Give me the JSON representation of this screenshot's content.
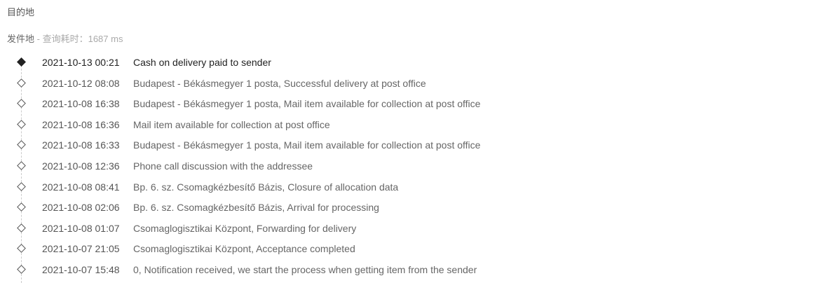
{
  "destination_label": "目的地",
  "origin": {
    "label": "发件地",
    "separator": " - ",
    "query_label": "查询耗时：",
    "query_value": "1687 ms"
  },
  "events": [
    {
      "time": "2021-10-13 00:21",
      "desc": "Cash on delivery paid to sender",
      "current": true
    },
    {
      "time": "2021-10-12 08:08",
      "desc": "Budapest - Békásmegyer 1 posta, Successful delivery at post office",
      "current": false
    },
    {
      "time": "2021-10-08 16:38",
      "desc": "Budapest - Békásmegyer 1 posta, Mail item available for collection at post office",
      "current": false
    },
    {
      "time": "2021-10-08 16:36",
      "desc": "Mail item available for collection at post office",
      "current": false
    },
    {
      "time": "2021-10-08 16:33",
      "desc": "Budapest - Békásmegyer 1 posta, Mail item available for collection at post office",
      "current": false
    },
    {
      "time": "2021-10-08 12:36",
      "desc": "Phone call discussion with the addressee",
      "current": false
    },
    {
      "time": "2021-10-08 08:41",
      "desc": "Bp. 6. sz. Csomagkézbesítő Bázis, Closure of allocation data",
      "current": false
    },
    {
      "time": "2021-10-08 02:06",
      "desc": "Bp. 6. sz. Csomagkézbesítő Bázis, Arrival for processing",
      "current": false
    },
    {
      "time": "2021-10-08 01:07",
      "desc": "Csomaglogisztikai Központ, Forwarding for delivery",
      "current": false
    },
    {
      "time": "2021-10-07 21:05",
      "desc": "Csomaglogisztikai Központ, Acceptance completed",
      "current": false
    },
    {
      "time": "2021-10-07 15:48",
      "desc": "0, Notification received, we start the process when getting item from the sender",
      "current": false
    }
  ]
}
